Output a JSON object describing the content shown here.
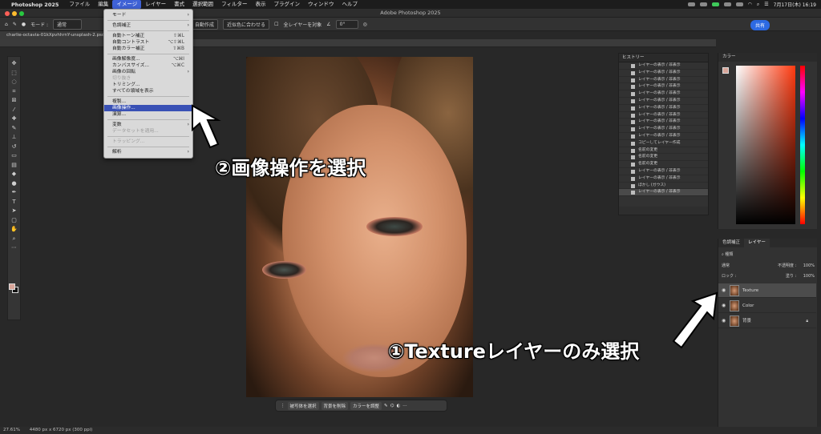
{
  "menubar": {
    "app_name": "Photoshop 2025",
    "items": [
      "ファイル",
      "編集",
      "イメージ",
      "レイヤー",
      "書式",
      "選択範囲",
      "フィルター",
      "表示",
      "プラグイン",
      "ウィンドウ",
      "ヘルプ"
    ],
    "active_index": 2,
    "datetime": "7月17日(木) 16:19"
  },
  "window": {
    "title": "Adobe Photoshop 2025"
  },
  "options_bar": {
    "mode_label": "モード :",
    "mode_value": "通常",
    "btn_auto": "自動作成",
    "btn_fit": "近似色に合わせる",
    "all_layers": "全レイヤーを対象",
    "angle": "0°",
    "share": "共有"
  },
  "document": {
    "tab": "charlie-octavia-01kXpvhhrnY-unsplash-2.psd"
  },
  "image_menu": {
    "items": [
      {
        "label": "モード",
        "arrow": true,
        "shortcut": "",
        "disabled": false
      },
      {
        "label": "色調補正",
        "arrow": true,
        "shortcut": "",
        "disabled": false
      },
      {
        "label": "自動トーン補正",
        "arrow": false,
        "shortcut": "⇧⌘L",
        "disabled": false
      },
      {
        "label": "自動コントラスト",
        "arrow": false,
        "shortcut": "⌥⇧⌘L",
        "disabled": false
      },
      {
        "label": "自動カラー補正",
        "arrow": false,
        "shortcut": "⇧⌘B",
        "disabled": false
      },
      {
        "label": "画像解像度...",
        "arrow": false,
        "shortcut": "⌥⌘I",
        "disabled": false
      },
      {
        "label": "カンバスサイズ...",
        "arrow": false,
        "shortcut": "⌥⌘C",
        "disabled": false
      },
      {
        "label": "画像の回転",
        "arrow": true,
        "shortcut": "",
        "disabled": false
      },
      {
        "label": "切り抜き",
        "arrow": false,
        "shortcut": "",
        "disabled": true
      },
      {
        "label": "トリミング...",
        "arrow": false,
        "shortcut": "",
        "disabled": false
      },
      {
        "label": "すべての領域を表示",
        "arrow": false,
        "shortcut": "",
        "disabled": false
      },
      {
        "label": "複製...",
        "arrow": false,
        "shortcut": "",
        "disabled": false
      },
      {
        "label": "画像操作...",
        "arrow": false,
        "shortcut": "",
        "disabled": false,
        "highlighted": true
      },
      {
        "label": "演算...",
        "arrow": false,
        "shortcut": "",
        "disabled": false
      },
      {
        "label": "変数",
        "arrow": true,
        "shortcut": "",
        "disabled": false
      },
      {
        "label": "データセットを適用...",
        "arrow": false,
        "shortcut": "",
        "disabled": true
      },
      {
        "label": "トラッピング...",
        "arrow": false,
        "shortcut": "",
        "disabled": true
      },
      {
        "label": "解析",
        "arrow": true,
        "shortcut": "",
        "disabled": false
      }
    ]
  },
  "history": {
    "title": "ヒストリー",
    "rows": [
      "レイヤーの表示 / 非表示",
      "レイヤーの表示 / 非表示",
      "レイヤーの表示 / 非表示",
      "レイヤーの表示 / 非表示",
      "レイヤーの表示 / 非表示",
      "レイヤーの表示 / 非表示",
      "レイヤーの表示 / 非表示",
      "レイヤーの表示 / 非表示",
      "レイヤーの表示 / 非表示",
      "レイヤーの表示 / 非表示",
      "レイヤーの表示 / 非表示",
      "コピーしてレイヤー作成",
      "名前の変更",
      "名前の変更",
      "名前の変更",
      "レイヤーの表示 / 非表示",
      "レイヤーの表示 / 非表示",
      "ぼかし (ガウス)",
      "レイヤーの表示 / 非表示"
    ]
  },
  "color_panel": {
    "title": "カラー",
    "fg_color": "#d8a599"
  },
  "layers_panel": {
    "tabs": [
      "色調補正",
      "レイヤー"
    ],
    "active_tab": 1,
    "filter": "種類",
    "blend_mode": "通常",
    "opacity_label": "不透明度 :",
    "opacity": "100%",
    "lock_label": "ロック :",
    "fill_label": "塗り :",
    "fill": "100%",
    "layers": [
      {
        "name": "Texture",
        "selected": true,
        "locked": false
      },
      {
        "name": "Color",
        "selected": false,
        "locked": false
      },
      {
        "name": "背景",
        "selected": false,
        "locked": true
      }
    ]
  },
  "context_bar": {
    "select_subject": "被写体を選択",
    "remove_bg": "背景を削除",
    "adjust_color": "カラーを調整"
  },
  "status": {
    "zoom": "27.61%",
    "dims": "4480 px x 6720 px (300 ppi)"
  },
  "annotations": {
    "step2": "②画像操作を選択",
    "step1": "①Textureレイヤーのみ選択"
  }
}
